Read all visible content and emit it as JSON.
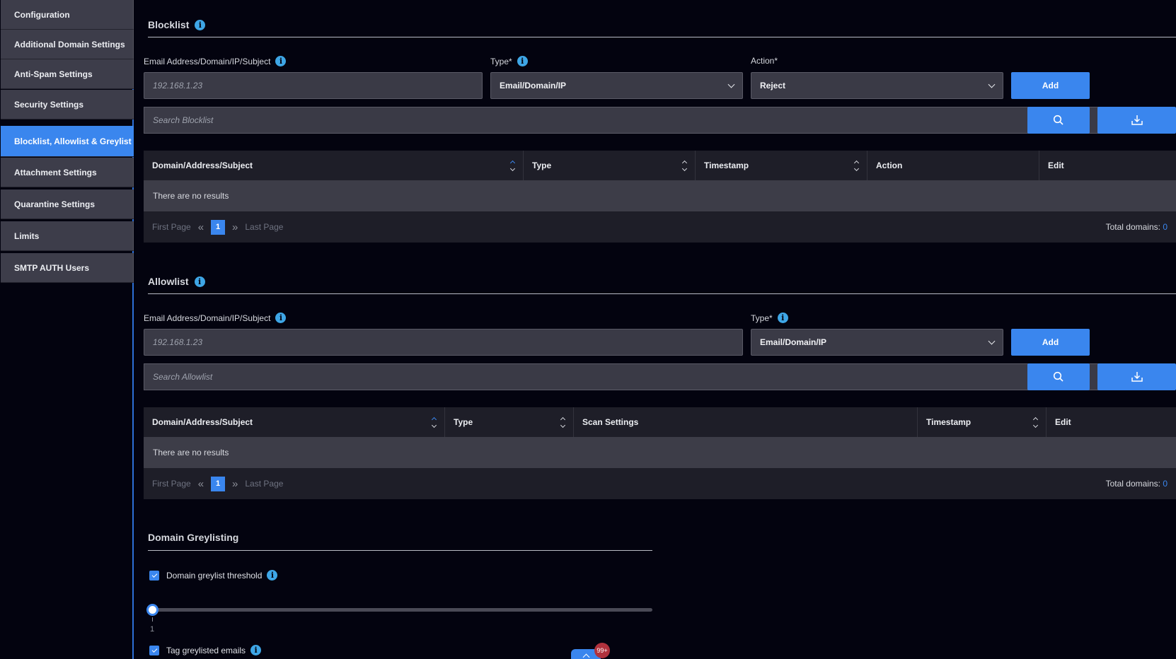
{
  "sidebar": {
    "items": [
      {
        "label": "Configuration",
        "active": false
      },
      {
        "label": "Additional Domain Settings",
        "active": false
      },
      {
        "label": "Anti-Spam Settings",
        "active": false
      },
      {
        "label": "Security Settings",
        "active": false
      },
      {
        "label": "Blocklist, Allowlist & Greylist",
        "active": true
      },
      {
        "label": "Attachment Settings",
        "active": false
      },
      {
        "label": "Quarantine Settings",
        "active": false
      },
      {
        "label": "Limits",
        "active": false
      },
      {
        "label": "SMTP AUTH Users",
        "active": false
      }
    ]
  },
  "blocklist": {
    "title": "Blocklist",
    "field_label": "Email Address/Domain/IP/Subject",
    "field_placeholder": "192.168.1.23",
    "type_label": "Type*",
    "type_value": "Email/Domain/IP",
    "action_label": "Action*",
    "action_value": "Reject",
    "add_label": "Add",
    "search_placeholder": "Search Blocklist",
    "columns": [
      "Domain/Address/Subject",
      "Type",
      "Timestamp",
      "Action",
      "Edit"
    ],
    "empty_text": "There are no results",
    "pager": {
      "first": "First Page",
      "page": "1",
      "last": "Last Page"
    },
    "total_label": "Total domains:",
    "total_value": "0"
  },
  "allowlist": {
    "title": "Allowlist",
    "field_label": "Email Address/Domain/IP/Subject",
    "field_placeholder": "192.168.1.23",
    "type_label": "Type*",
    "type_value": "Email/Domain/IP",
    "add_label": "Add",
    "search_placeholder": "Search Allowlist",
    "columns": [
      "Domain/Address/Subject",
      "Type",
      "Scan Settings",
      "Timestamp",
      "Edit"
    ],
    "empty_text": "There are no results",
    "pager": {
      "first": "First Page",
      "page": "1",
      "last": "Last Page"
    },
    "total_label": "Total domains:",
    "total_value": "0"
  },
  "greylisting": {
    "title": "Domain Greylisting",
    "threshold_label": "Domain greylist threshold",
    "threshold_checked": true,
    "slider_value": "1",
    "tag_label": "Tag greylisted emails",
    "tag_checked": true
  },
  "notifications": {
    "badge": "99+"
  },
  "icons": {
    "info": "info-icon",
    "search": "search-icon",
    "download": "download-icon",
    "chevron": "chevron-down-icon",
    "sort": "sort-icon"
  },
  "colors": {
    "accent": "#3a86ee",
    "background": "#03030f",
    "panel": "#3d3d48",
    "info": "#3ea6e6",
    "badge": "#b0323d"
  }
}
